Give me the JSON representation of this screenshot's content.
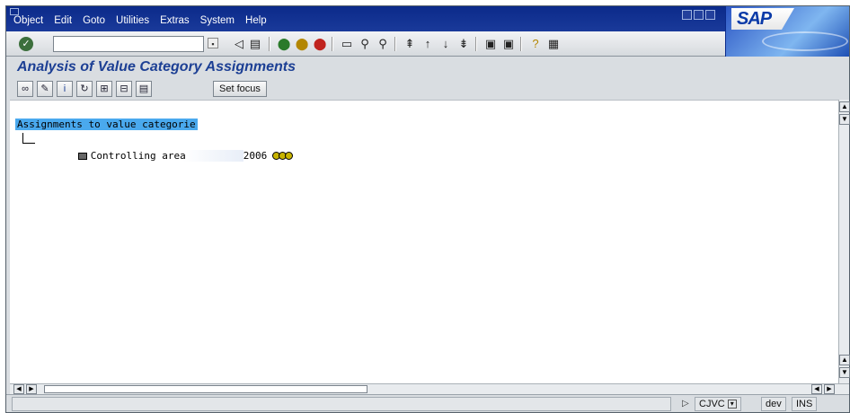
{
  "menu": {
    "items": [
      "Object",
      "Edit",
      "Goto",
      "Utilities",
      "Extras",
      "System",
      "Help"
    ]
  },
  "brand": {
    "logo_text": "SAP",
    "accent": "#1c3f94"
  },
  "page": {
    "title": "Analysis of Value Category Assignments"
  },
  "app_toolbar": {
    "set_focus_label": "Set focus"
  },
  "tree": {
    "root_label": "Assignments to value categorie",
    "node": {
      "label": "Controlling area",
      "value": "2006",
      "status_icon": "traffic-lights-icon"
    }
  },
  "status_bar": {
    "transaction": "CJVC",
    "system": "dev",
    "mode": "INS"
  }
}
